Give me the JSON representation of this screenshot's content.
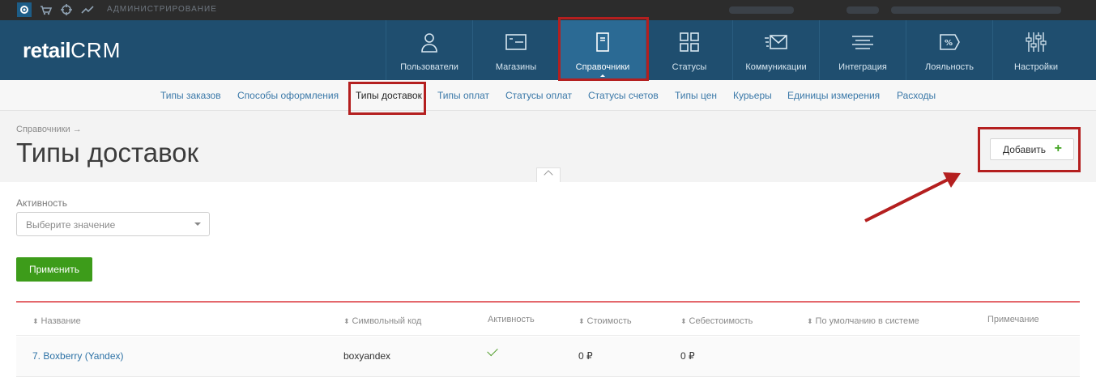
{
  "topbar": {
    "admin_label": "АДМИНИСТРИРОВАНИЕ",
    "icons": [
      "gear-icon",
      "cart-icon",
      "crosshair-icon",
      "chart-icon"
    ]
  },
  "header": {
    "logo_prefix": "retail",
    "logo_suffix": "CRM",
    "nav": [
      {
        "label": "Пользователи",
        "icon": "user-icon"
      },
      {
        "label": "Магазины",
        "icon": "store-icon"
      },
      {
        "label": "Справочники",
        "icon": "document-icon",
        "active": true
      },
      {
        "label": "Статусы",
        "icon": "grid-icon"
      },
      {
        "label": "Коммуникации",
        "icon": "envelope-icon"
      },
      {
        "label": "Интеграция",
        "icon": "lines-icon"
      },
      {
        "label": "Лояльность",
        "icon": "percent-tag-icon"
      },
      {
        "label": "Настройки",
        "icon": "sliders-icon"
      }
    ]
  },
  "subnav": {
    "items": [
      "Типы заказов",
      "Способы оформления",
      "Типы доставок",
      "Типы оплат",
      "Статусы оплат",
      "Статусы счетов",
      "Типы цен",
      "Курьеры",
      "Единицы измерения",
      "Расходы"
    ],
    "active": "Типы доставок"
  },
  "page": {
    "breadcrumb": "Справочники →",
    "title": "Типы доставок",
    "add_button": "Добавить",
    "add_plus": "+"
  },
  "filter": {
    "label": "Активность",
    "placeholder": "Выберите значение",
    "apply_button": "Применить"
  },
  "table": {
    "columns": [
      "Название",
      "Символьный код",
      "Активность",
      "Стоимость",
      "Себестоимость",
      "По умолчанию в системе",
      "Примечание"
    ],
    "rows": [
      {
        "name": "7. Boxberry (Yandex)",
        "code": "boxyandex",
        "active": true,
        "cost": "0 ₽",
        "self_cost": "0 ₽",
        "default": "",
        "note": ""
      }
    ]
  },
  "colors": {
    "header_bg": "#1f4e6f",
    "active_nav": "#2b6a94",
    "apply_green": "#3d9c1a",
    "highlight_red": "#b41f1f",
    "table_top_border": "#e4686c"
  }
}
